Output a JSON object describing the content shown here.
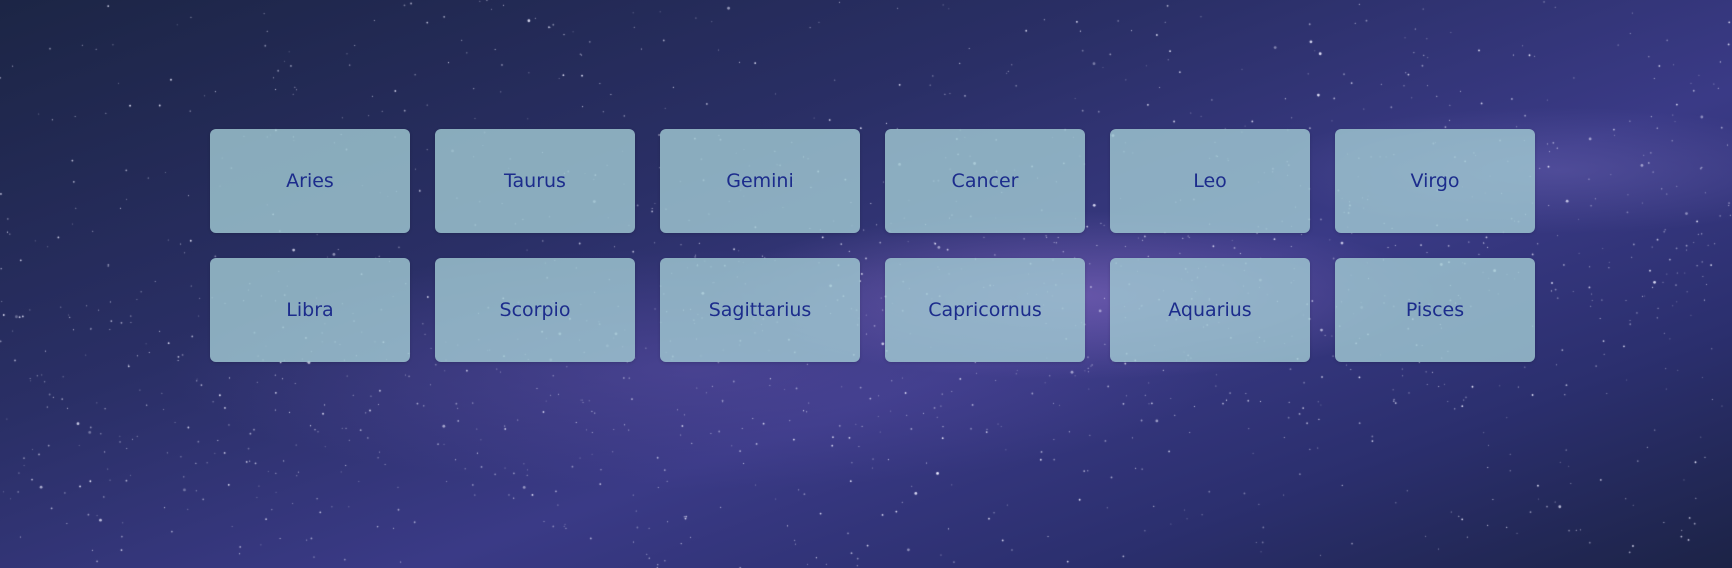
{
  "colors": {
    "card_background": "#a0c8d2",
    "label_text": "#1c2c8c",
    "sky_dark": "#1c2545",
    "sky_mid": "#3a3a86"
  },
  "zodiac": {
    "signs": [
      {
        "label": "Aries"
      },
      {
        "label": "Taurus"
      },
      {
        "label": "Gemini"
      },
      {
        "label": "Cancer"
      },
      {
        "label": "Leo"
      },
      {
        "label": "Virgo"
      },
      {
        "label": "Libra"
      },
      {
        "label": "Scorpio"
      },
      {
        "label": "Sagittarius"
      },
      {
        "label": "Capricornus"
      },
      {
        "label": "Aquarius"
      },
      {
        "label": "Pisces"
      }
    ]
  }
}
